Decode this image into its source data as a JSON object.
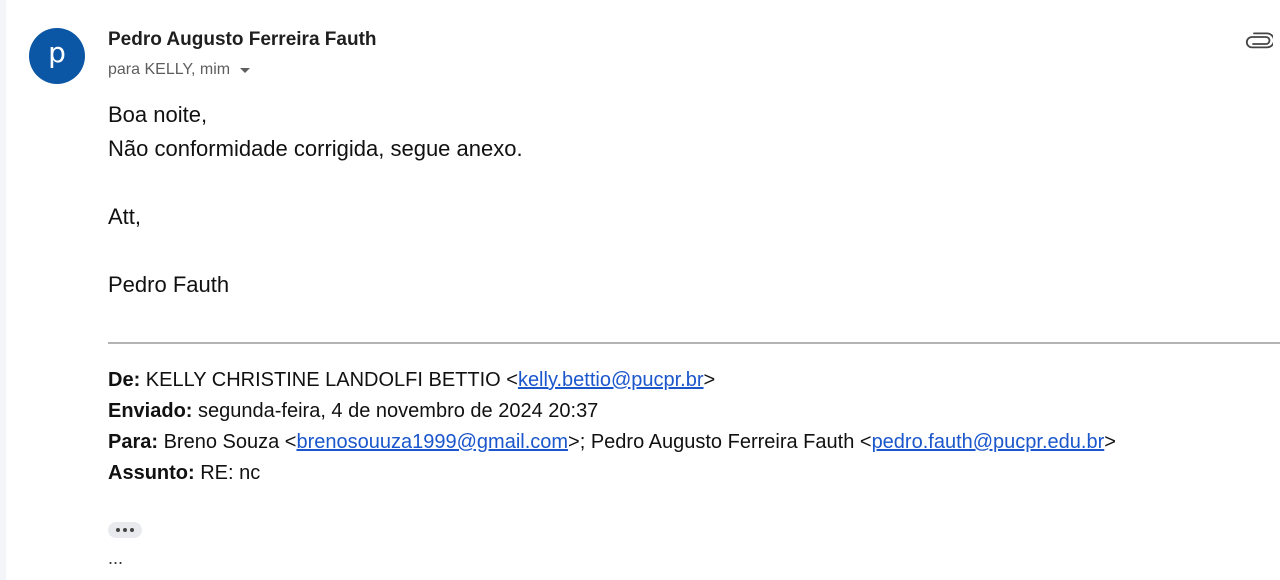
{
  "message": {
    "avatar_letter": "p",
    "avatar_color": "#0b57a5",
    "sender_name": "Pedro Augusto Ferreira Fauth",
    "recipients_label": "para KELLY, mim",
    "icons": {
      "attachment": "paperclip-icon",
      "recipients_toggle": "caret-down-icon",
      "show_trimmed": "ellipsis-icon"
    },
    "body_lines": [
      "Boa noite,",
      "Não conformidade corrigida, segue anexo.",
      "",
      "Att,",
      "",
      "Pedro Fauth"
    ]
  },
  "quoted": {
    "from_label": "De:",
    "from_name": "KELLY CHRISTINE LANDOLFI BETTIO <",
    "from_email": "kelly.bettio@pucpr.br",
    "from_close": ">",
    "sent_label": "Enviado:",
    "sent_value": "segunda-feira, 4 de novembro de 2024 20:37",
    "to_label": "Para:",
    "to_name_1": "Breno Souza <",
    "to_email_1": "brenosouuza1999@gmail.com",
    "to_sep": ">; Pedro Augusto Ferreira Fauth <",
    "to_email_2": "pedro.fauth@pucpr.edu.br",
    "to_close": ">",
    "subject_label": "Assunto:",
    "subject_value": "RE: nc"
  },
  "trailing_text": "..."
}
